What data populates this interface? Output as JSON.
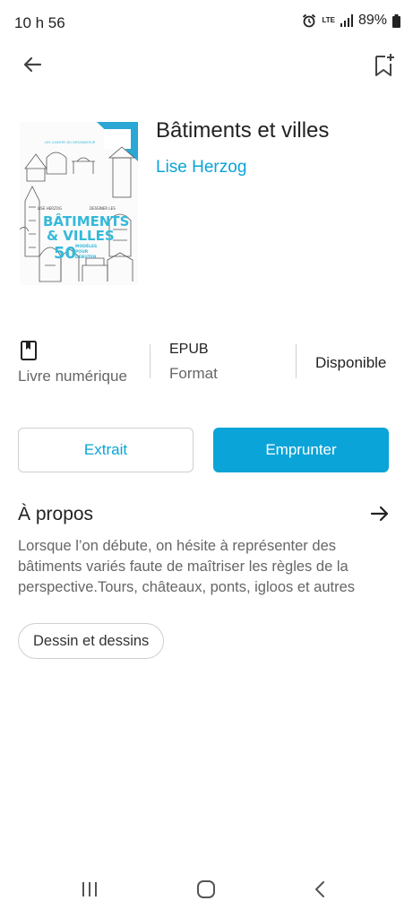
{
  "status_bar": {
    "time": "10 h 56",
    "network": "LTE",
    "battery": "89%"
  },
  "top_bar": {
    "back_icon": "arrow-left-icon",
    "bookmark_icon": "bookmark-add-icon"
  },
  "book": {
    "title": "Bâtiments et villes",
    "author": "Lise Herzog",
    "cover": {
      "small_header": "LES CAHIERS DU DESSINATEUR",
      "series_left": "LISE HERZOG",
      "series_right": "DESSINER LES",
      "title_line1": "BÂTIMENTS",
      "title_line2": "& VILLES",
      "number": "50",
      "subtitle_line1": "MODÈLES",
      "subtitle_line2": "POUR",
      "subtitle_line3": "DÉBUTER"
    }
  },
  "info": {
    "type_label": "Livre numérique",
    "type_icon": "book-icon",
    "format_value": "EPUB",
    "format_label": "Format",
    "availability": "Disponible"
  },
  "actions": {
    "extract_label": "Extrait",
    "borrow_label": "Emprunter"
  },
  "about": {
    "title": "À propos",
    "text": "Lorsque l’on débute, on hésite à représenter des bâtiments variés faute de maîtriser les règles de la perspective.Tours, châteaux, ponts, igloos et autres"
  },
  "tags": [
    "Dessin et dessins"
  ],
  "colors": {
    "accent": "#0aa4d8",
    "cover_title": "#35b9d9"
  }
}
